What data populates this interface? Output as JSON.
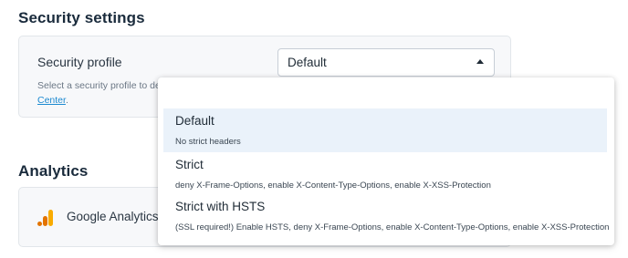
{
  "security": {
    "heading": "Security settings",
    "profile_label": "Security profile",
    "help_text": "Select a security profile to det",
    "help_link": "Center",
    "help_suffix": ".",
    "selected_value": "Default",
    "options": [
      {
        "label": "Default",
        "description": "No strict headers"
      },
      {
        "label": "Strict",
        "description": "deny X-Frame-Options, enable X-Content-Type-Options, enable X-XSS-Protection"
      },
      {
        "label": "Strict with HSTS",
        "description": "(SSL required!) Enable HSTS, deny X-Frame-Options, enable X-Content-Type-Options, enable X-XSS-Protection"
      }
    ]
  },
  "analytics": {
    "heading": "Analytics",
    "item_label": "Google Analytics",
    "icon": "google-analytics-icon"
  },
  "colors": {
    "link": "#1d8ad0",
    "selected_option_bg": "#eaf2fa",
    "ga_orange": "#f9ab00",
    "ga_dark_orange": "#e37400"
  }
}
